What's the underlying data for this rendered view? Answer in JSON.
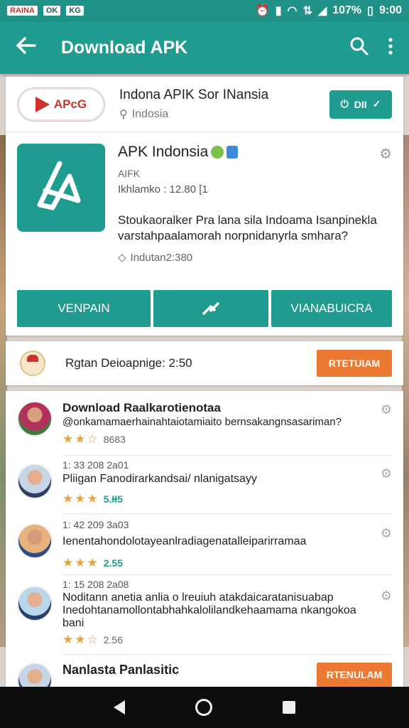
{
  "status_bar": {
    "chip_red": "RAINA",
    "chip_1": "OK",
    "chip_2": "KG",
    "battery": "107%",
    "time": "9:00"
  },
  "app_bar": {
    "title": "Download APK"
  },
  "header_item": {
    "logo_text": "APcG",
    "title": "Indona APIK Sor INansia",
    "location": "Indosia",
    "button_label": "DII"
  },
  "app": {
    "name": "APK Indonsia",
    "developer": "AIFK",
    "meta": "Ikhlamko : 12.80 [1",
    "description": "Stoukaoralker Pra lana sila Indoama Isanpinekla varstahpaalamorah norpnidanyrla smhara?",
    "size": "Indutan2:380"
  },
  "actions": {
    "left": "VENPAIN",
    "right": "VIANABUICRA"
  },
  "promo": {
    "text": "Rgtan Deioapnige: 2:50",
    "button": "RTETUIAM"
  },
  "reviews": [
    {
      "title": "Download Raalkarotienotaa",
      "text": "@onkamamaerhainahtaiotamiaito bernsakangnsasariman?",
      "rating_value": "8683",
      "stars": 2.5
    },
    {
      "stamp": "1: 33 208 2a01",
      "text": "Pliigan Fanodirarkandsai/ nlanigatsayy",
      "rating_value": "5.ƗƗ5",
      "stars": 3
    },
    {
      "stamp": "1: 42 209 3a03",
      "text": "Ienentahondolotayeanlradiagenatalleiparirramaa",
      "rating_value": "2.55",
      "stars": 3
    },
    {
      "stamp": "1: 15 208 2a08",
      "text": "Noditann anetia anlia o lreuiuh atakdaicaratanisuabap Inedohtanamollontabhahkalolilandkehaamama nkangokoa bani",
      "rating_value": "2.56",
      "stars": 2.5
    },
    {
      "title": "Nanlasta Panlasitic",
      "button": "RTENULAM"
    }
  ]
}
